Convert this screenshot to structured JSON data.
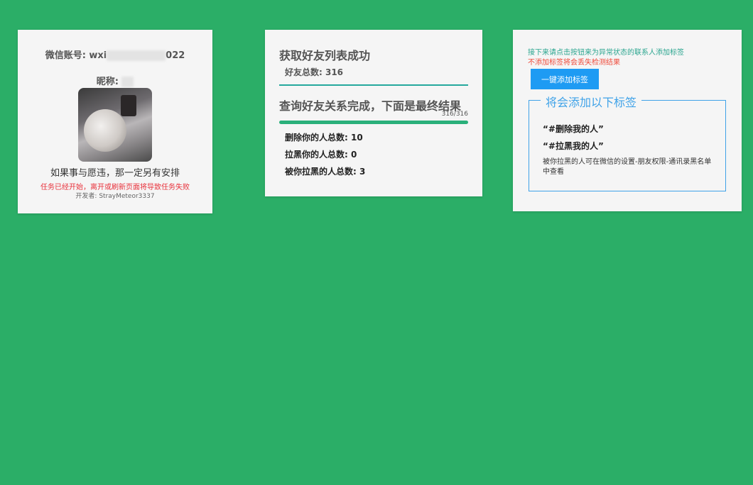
{
  "profile": {
    "account_label": "微信账号: wxi",
    "account_hidden": "d_xxxxxxxx",
    "account_suffix": "022",
    "nickname_label": "昵称:",
    "nickname_hidden": "xx",
    "wish_text": "如果事与愿违，那一定另有安排",
    "warning_text": "任务已经开始，离开或刷新页面将导致任务失败",
    "developer_text": "开发者: StrayMeteor3337"
  },
  "result": {
    "title_fetch": "获取好友列表成功",
    "total_friends": "好友总数: 316",
    "title_query": "查询好友关系完成，下面是最终结果",
    "progress_text": "316/316",
    "progress_value": 1.0,
    "stat_deleted": "删除你的人总数: 10",
    "stat_blocked_you": "拉黑你的人总数: 0",
    "stat_blocked_by_you": "被你拉黑的人总数: 3"
  },
  "tags": {
    "info_text": "接下来请点击按钮来为异常状态的联系人添加标签",
    "warning_text": "不添加标签将会丢失检测结果",
    "button_label": "一键添加标签",
    "box_title": "将会添加以下标签",
    "tag1": "“#删除我的人”",
    "tag2": "“#拉黑我的人”",
    "note": "被你拉黑的人可在微信的设置-朋友权限-通讯录黑名单中查看"
  },
  "colors": {
    "background": "#2bae67",
    "accent_blue": "#1e9bf3",
    "warning_red": "#e8313b",
    "progress_green": "#2ab07a"
  }
}
